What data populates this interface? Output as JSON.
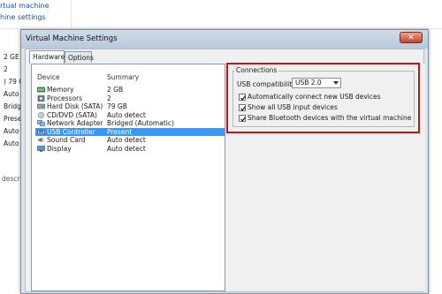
{
  "background": {
    "links": [
      "rtual machine",
      "hine settings"
    ],
    "values": [
      "2 GE",
      "2",
      ") 79 G",
      "Auto",
      "Bridg",
      "Prese",
      "Auto",
      "Auto"
    ],
    "desc": "descr"
  },
  "dialog": {
    "title": "Virtual Machine Settings",
    "close_glyph": "✕",
    "tabs": [
      {
        "label": "Hardware",
        "active": true
      },
      {
        "label": "Options",
        "active": false
      }
    ],
    "columns": {
      "device": "Device",
      "summary": "Summary"
    },
    "devices": [
      {
        "name": "Memory",
        "summary": "2 GB",
        "icon": "memory-icon",
        "selected": false
      },
      {
        "name": "Processors",
        "summary": "2",
        "icon": "processor-icon",
        "selected": false
      },
      {
        "name": "Hard Disk (SATA)",
        "summary": "79 GB",
        "icon": "hard-disk-icon",
        "selected": false
      },
      {
        "name": "CD/DVD (SATA)",
        "summary": "Auto detect",
        "icon": "cd-dvd-icon",
        "selected": false
      },
      {
        "name": "Network Adapter",
        "summary": "Bridged (Automatic)",
        "icon": "network-adapter-icon",
        "selected": false
      },
      {
        "name": "USB Controller",
        "summary": "Present",
        "icon": "usb-controller-icon",
        "selected": true
      },
      {
        "name": "Sound Card",
        "summary": "Auto detect",
        "icon": "sound-card-icon",
        "selected": false
      },
      {
        "name": "Display",
        "summary": "Auto detect",
        "icon": "display-icon",
        "selected": false
      }
    ],
    "connections": {
      "group_label": "Connections",
      "usb_compat_label": "USB compatibility:",
      "usb_compat_value": "USB 2.0",
      "checkboxes": [
        {
          "label": "Automatically connect new USB devices",
          "checked": true
        },
        {
          "label": "Show all USB input devices",
          "checked": true
        },
        {
          "label": "Share Bluetooth devices with the virtual machine",
          "checked": true
        }
      ]
    },
    "colors": {
      "selection": "#3399ff",
      "highlight_border": "#c4141b"
    }
  }
}
